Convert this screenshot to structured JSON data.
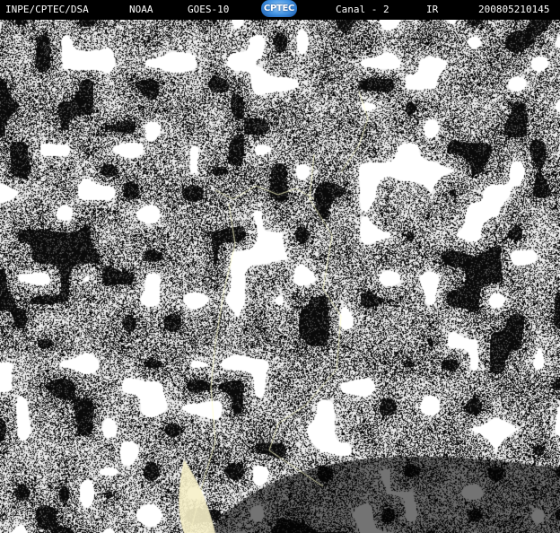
{
  "header": {
    "source": "INPE/CPTEC/DSA",
    "agency": "NOAA",
    "satellite": "GOES-10",
    "logo_text": "CPTEC",
    "channel": "Canal - 2",
    "band": "IR",
    "timestamp": "200805210145"
  },
  "colors": {
    "background": "#000000",
    "cloud": "#ffffff",
    "border_lines": "#ffffcc"
  }
}
